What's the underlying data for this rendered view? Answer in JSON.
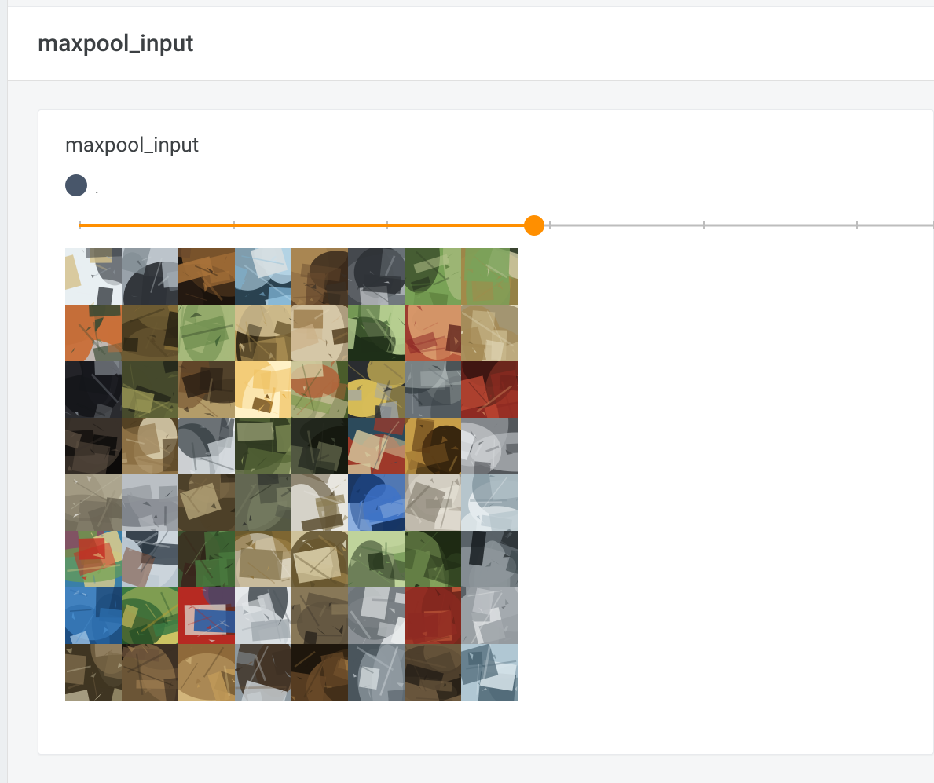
{
  "section": {
    "title": "maxpool_input"
  },
  "card": {
    "title": "maxpool_input",
    "run": {
      "label": ".",
      "color": "#48566a"
    },
    "slider": {
      "min": 0,
      "max": 100,
      "value": 55,
      "ticks": [
        0,
        18,
        36,
        55,
        73,
        91,
        100
      ],
      "accent": "#ff8f00"
    },
    "grid": {
      "cols": 8,
      "rows": 8,
      "tiles": [
        {
          "seed": 687032,
          "palette": [
            "#e8eef2",
            "#9aa6ae",
            "#2f343a",
            "#d4c08a"
          ]
        },
        {
          "seed": 570113,
          "palette": [
            "#cfd6da",
            "#7f8a92",
            "#2a2e33",
            "#b9c2c9"
          ]
        },
        {
          "seed": 14640,
          "palette": [
            "#3a2a1e",
            "#6d4a2c",
            "#a9733a",
            "#1b140d"
          ]
        },
        {
          "seed": 765053,
          "palette": [
            "#bfe0f2",
            "#7fb6d6",
            "#d7dee1",
            "#2a4250"
          ]
        },
        {
          "seed": 975464,
          "palette": [
            "#2d2016",
            "#674a2d",
            "#3a3026",
            "#ae8b55"
          ]
        },
        {
          "seed": 914553,
          "palette": [
            "#6a7176",
            "#a7adb1",
            "#2f3337",
            "#d1d5d8"
          ]
        },
        {
          "seed": 573444,
          "palette": [
            "#79a257",
            "#5a7c3b",
            "#b7c48d",
            "#2d3b22"
          ]
        },
        {
          "seed": 239059,
          "palette": [
            "#7aa35a",
            "#a28a4a",
            "#3a4530",
            "#d0cda8"
          ]
        },
        {
          "seed": 585726,
          "palette": [
            "#bcd7e8",
            "#3a4a33",
            "#c9703a",
            "#6f7f52"
          ]
        },
        {
          "seed": 316278,
          "palette": [
            "#4a3c20",
            "#6e5b33",
            "#2b2414",
            "#8d7338"
          ]
        },
        {
          "seed": 584294,
          "palette": [
            "#3e5f33",
            "#6c8c4d",
            "#2a3b22",
            "#a7b97b"
          ]
        },
        {
          "seed": 670389,
          "palette": [
            "#b79a5a",
            "#6e5a31",
            "#d8c596",
            "#2e2514"
          ]
        },
        {
          "seed": 371829,
          "palette": [
            "#9a7a4a",
            "#cbb187",
            "#5b4628",
            "#e4d7b7"
          ]
        },
        {
          "seed": 337025,
          "palette": [
            "#3a5a2e",
            "#7fa55c",
            "#1f2f18",
            "#b7cf91"
          ]
        },
        {
          "seed": 806670,
          "palette": [
            "#8e2a28",
            "#b85a3e",
            "#501614",
            "#d89a6b"
          ]
        },
        {
          "seed": 475637,
          "palette": [
            "#a58a55",
            "#c8b78b",
            "#6b5830",
            "#e0d7b8"
          ]
        },
        {
          "seed": 930807,
          "palette": [
            "#2a2b2f",
            "#55585d",
            "#15161a",
            "#7e848b"
          ]
        },
        {
          "seed": 93106,
          "palette": [
            "#46492c",
            "#6c6f3e",
            "#23251a",
            "#a6a35b"
          ]
        },
        {
          "seed": 131966,
          "palette": [
            "#2c2116",
            "#6c4a28",
            "#b39c6a",
            "#3a2c1b"
          ]
        },
        {
          "seed": 572237,
          "palette": [
            "#e3a12b",
            "#f0c468",
            "#6b4612",
            "#fff1c7"
          ]
        },
        {
          "seed": 571002,
          "palette": [
            "#7f9a4e",
            "#b0633a",
            "#4a5c2b",
            "#d7cda3"
          ]
        },
        {
          "seed": 152340,
          "palette": [
            "#a0a6ab",
            "#6e6046",
            "#d8bd58",
            "#2a2d30"
          ]
        },
        {
          "seed": 637932,
          "palette": [
            "#3a4247",
            "#6a7278",
            "#20272c",
            "#a6aeae"
          ]
        },
        {
          "seed": 936165,
          "palette": [
            "#8e2a22",
            "#c04a34",
            "#3b1511",
            "#e2a06d"
          ]
        },
        {
          "seed": 923564,
          "palette": [
            "#1d1916",
            "#3a322a",
            "#0c0a09",
            "#5d5043"
          ]
        },
        {
          "seed": 662200,
          "palette": [
            "#b59d73",
            "#8c7044",
            "#d9cead",
            "#4b3a1f"
          ]
        },
        {
          "seed": 529842,
          "palette": [
            "#cdd3d7",
            "#8b9298",
            "#e8eaec",
            "#3a4246"
          ]
        },
        {
          "seed": 93408,
          "palette": [
            "#5a6b3a",
            "#8f9c60",
            "#2e3820",
            "#c0c694"
          ]
        },
        {
          "seed": 713218,
          "palette": [
            "#2a2f24",
            "#4d5540",
            "#15180f",
            "#7d8260"
          ]
        },
        {
          "seed": 574927,
          "palette": [
            "#9e3a2a",
            "#5b8a9e",
            "#2a4b5c",
            "#d4c79c"
          ]
        },
        {
          "seed": 921949,
          "palette": [
            "#5a3914",
            "#8a5f26",
            "#2d1d0a",
            "#caa04a"
          ]
        },
        {
          "seed": 686676,
          "palette": [
            "#8a8f94",
            "#b4b8bc",
            "#53575b",
            "#e0e3e5"
          ]
        },
        {
          "seed": 458160,
          "palette": [
            "#efeee8",
            "#c3bfa8",
            "#99917a",
            "#6a6454"
          ]
        },
        {
          "seed": 993208,
          "palette": [
            "#8f949a",
            "#5b6168",
            "#babfc4",
            "#2f343a"
          ]
        },
        {
          "seed": 365853,
          "palette": [
            "#7a6646",
            "#4d3f28",
            "#b0a075",
            "#2a2315"
          ]
        },
        {
          "seed": 698689,
          "palette": [
            "#2c2f2a",
            "#535848",
            "#15170f",
            "#7d8266"
          ]
        },
        {
          "seed": 144342,
          "palette": [
            "#e8e6df",
            "#c6bfa6",
            "#8d7e55",
            "#5a4c30"
          ]
        },
        {
          "seed": 985251,
          "palette": [
            "#1f4a8e",
            "#3e74c8",
            "#0e2a55",
            "#8eb0e0"
          ]
        },
        {
          "seed": 877744,
          "palette": [
            "#9a9386",
            "#c9c3b5",
            "#615b4d",
            "#e8e4d8"
          ]
        },
        {
          "seed": 269059,
          "palette": [
            "#e4ebee",
            "#b6c5cc",
            "#7a8e98",
            "#3a4a52"
          ]
        },
        {
          "seed": 977986,
          "palette": [
            "#3a7fa8",
            "#c62a22",
            "#6ca04a",
            "#e8d28a"
          ]
        },
        {
          "seed": 306350,
          "palette": [
            "#b9c5cf",
            "#7a4a32",
            "#2a3640",
            "#d7dde2"
          ]
        },
        {
          "seed": 327062,
          "palette": [
            "#4a7a3e",
            "#3a241b",
            "#86a86c",
            "#1d2a16"
          ]
        },
        {
          "seed": 938733,
          "palette": [
            "#b89a5b",
            "#e8e3d6",
            "#6b5a2d",
            "#8c7038"
          ]
        },
        {
          "seed": 407430,
          "palette": [
            "#e9e5cf",
            "#b09355",
            "#5a4a28",
            "#cfc29a"
          ]
        },
        {
          "seed": 736687,
          "palette": [
            "#496a3c",
            "#7ea35e",
            "#24351c",
            "#bfd39b"
          ]
        },
        {
          "seed": 51297,
          "palette": [
            "#5a7c3e",
            "#3a4f28",
            "#8aa860",
            "#1e2a14"
          ]
        },
        {
          "seed": 34843,
          "palette": [
            "#2f3a3e",
            "#596268",
            "#151b1e",
            "#8d969b"
          ]
        },
        {
          "seed": 56570,
          "palette": [
            "#2a6aa8",
            "#4a8fcf",
            "#11335a",
            "#a0c4e4"
          ]
        },
        {
          "seed": 554137,
          "palette": [
            "#3a7a42",
            "#d4a22a",
            "#1f4a24",
            "#e8d06a"
          ]
        },
        {
          "seed": 958701,
          "palette": [
            "#b62a22",
            "#2a5aa0",
            "#d8cfc6",
            "#6a2a18"
          ]
        },
        {
          "seed": 466519,
          "palette": [
            "#9aa2a8",
            "#cfd4d8",
            "#4a5258",
            "#e6e9eb"
          ]
        },
        {
          "seed": 494242,
          "palette": [
            "#3a3228",
            "#5e523e",
            "#1d1914",
            "#887858"
          ]
        },
        {
          "seed": 116567,
          "palette": [
            "#a7adb1",
            "#d5d9dc",
            "#6a7075",
            "#ebedee"
          ]
        },
        {
          "seed": 685236,
          "palette": [
            "#8e2a22",
            "#3a1411",
            "#c05a3a",
            "#6a2218"
          ]
        },
        {
          "seed": 96738,
          "palette": [
            "#9aa0a5",
            "#c9cdd1",
            "#5a6065",
            "#e5e7e9"
          ]
        },
        {
          "seed": 881538,
          "palette": [
            "#7d6a4a",
            "#b5a880",
            "#3f3522",
            "#d6ceae"
          ]
        },
        {
          "seed": 287598,
          "palette": [
            "#3a2e22",
            "#6b523a",
            "#1d160e",
            "#9a7a4e"
          ]
        },
        {
          "seed": 804864,
          "palette": [
            "#8e6a3a",
            "#c09a58",
            "#4e3a1f",
            "#e0c68a"
          ]
        },
        {
          "seed": 345611,
          "palette": [
            "#c9d0d4",
            "#3a2e22",
            "#8e99a0",
            "#6b523a"
          ]
        },
        {
          "seed": 410006,
          "palette": [
            "#6a4a28",
            "#3a2a16",
            "#9c7640",
            "#1e160c"
          ]
        },
        {
          "seed": 337744,
          "palette": [
            "#e8eef0",
            "#c4cbd0",
            "#8f99a0",
            "#4a555c"
          ]
        },
        {
          "seed": 866192,
          "palette": [
            "#1f1a14",
            "#4a3c2a",
            "#0d0a07",
            "#6e5a3f"
          ]
        },
        {
          "seed": 204024,
          "palette": [
            "#b0c7d3",
            "#7a99aa",
            "#4a6472",
            "#d9e5eb"
          ]
        }
      ]
    }
  }
}
